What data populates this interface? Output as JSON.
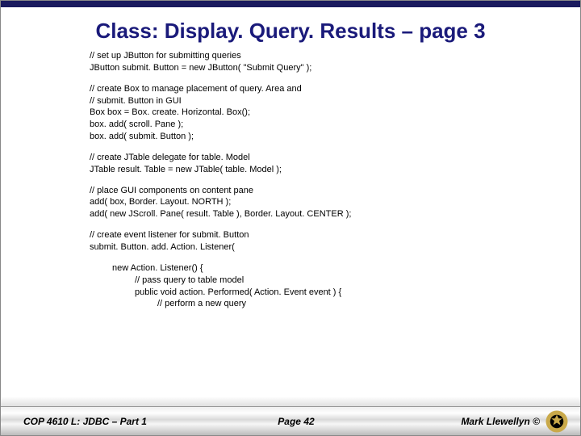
{
  "title": "Class:  Display. Query. Results – page 3",
  "code": {
    "b1": [
      "// set up JButton for submitting queries",
      "JButton submit. Button = new JButton( \"Submit Query\" );"
    ],
    "b2": [
      "// create Box to manage placement of query. Area and",
      "// submit. Button in GUI",
      "Box box = Box. create. Horizontal. Box();",
      "box. add( scroll. Pane );",
      "box. add( submit. Button );"
    ],
    "b3": [
      "// create JTable delegate for table. Model",
      "JTable result. Table = new JTable( table. Model );"
    ],
    "b4": [
      "// place GUI components on content pane",
      "add( box, Border. Layout. NORTH );",
      "add( new JScroll. Pane( result. Table ), Border. Layout. CENTER );"
    ],
    "b5": [
      "// create event listener for submit. Button",
      "submit. Button. add. Action. Listener("
    ],
    "b6": {
      "l1": "new Action. Listener() {",
      "l2": "// pass query to table model",
      "l3": "public void action. Performed( Action. Event event ) {",
      "l4": "// perform a new query"
    }
  },
  "footer": {
    "left": "COP 4610 L: JDBC – Part 1",
    "center": "Page 42",
    "right": "Mark Llewellyn ©"
  },
  "colors": {
    "title": "#1a1a7a",
    "topbar": "#1a1a5e",
    "logo_outer": "#c9a94a",
    "logo_inner": "#000000"
  }
}
